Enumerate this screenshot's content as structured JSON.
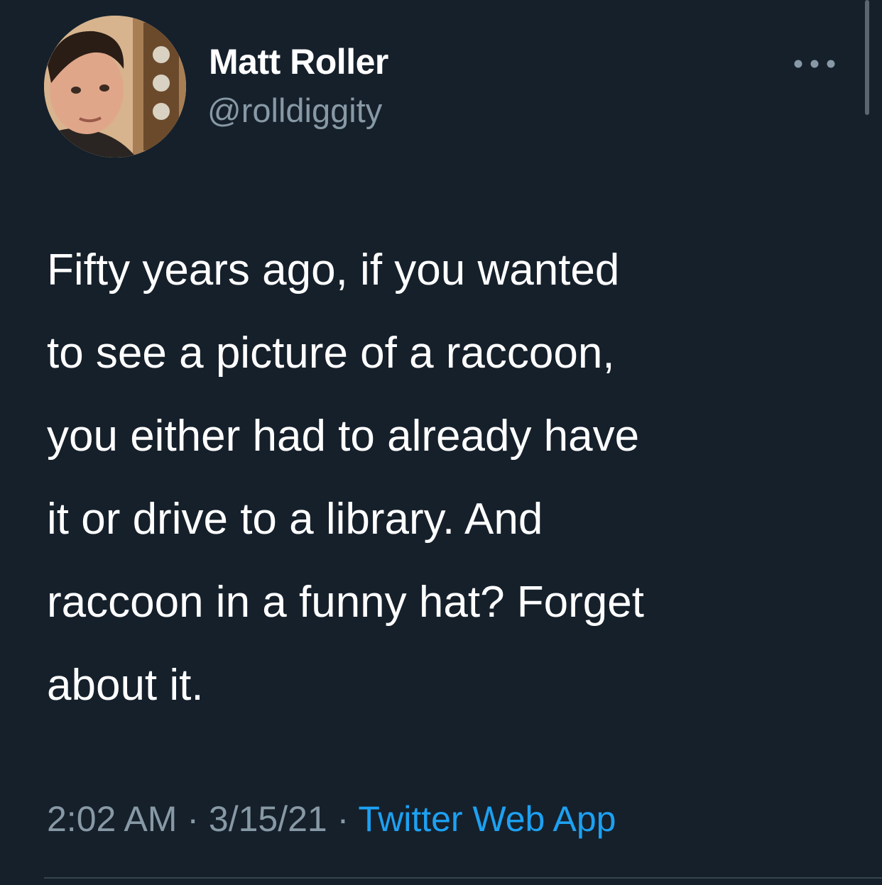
{
  "author": {
    "name": "Matt Roller",
    "handle": "@rolldiggity"
  },
  "tweet": {
    "text_lines": [
      "Fifty years ago, if you wanted",
      "to see a picture of a raccoon,",
      "you either had to already have",
      "it or drive to a library. And",
      "raccoon in a funny hat? Forget",
      "about it."
    ]
  },
  "meta": {
    "time": "2:02 AM",
    "separator": "·",
    "date": "3/15/21",
    "source": "Twitter Web App"
  },
  "icons": {
    "more": "more-horizontal-icon",
    "avatar": "profile-photo"
  },
  "colors": {
    "background": "#15202b",
    "primary_text": "#ffffff",
    "secondary_text": "#8899a6",
    "link": "#1da1f2",
    "divider": "#38444d"
  }
}
